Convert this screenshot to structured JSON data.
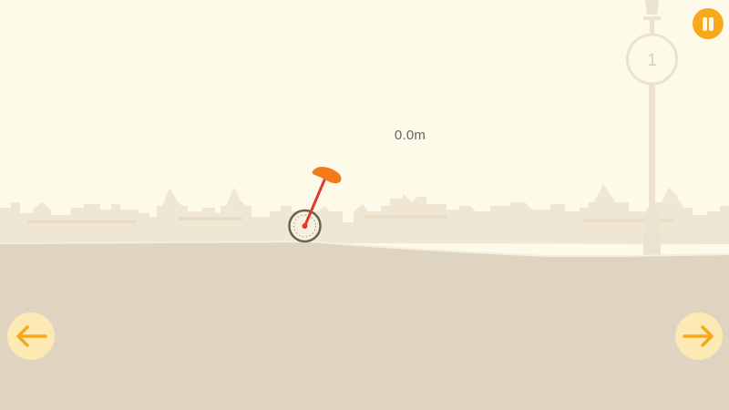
{
  "hud": {
    "distance": "0.0m",
    "level": "1"
  },
  "controls": {
    "pause_icon": "pause-icon",
    "left_icon": "arrow-left-icon",
    "right_icon": "arrow-right-icon"
  },
  "colors": {
    "sky": "#fdfaea",
    "ground": "#dfd4bf",
    "skyline": "#efe6d3",
    "accent": "#f6a91c",
    "button_bg": "#fce9b3",
    "unicycle_frame": "#e0392f",
    "unicycle_seat": "#f27a1a"
  }
}
